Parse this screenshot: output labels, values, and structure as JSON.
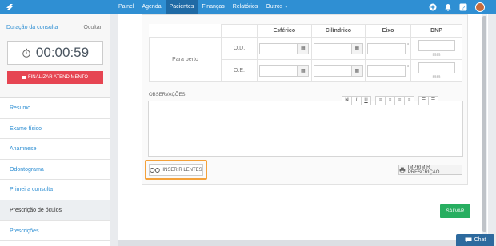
{
  "topbar": {
    "nav": [
      "Painel",
      "Agenda",
      "Pacientes",
      "Finanças",
      "Relatórios",
      "Outros"
    ],
    "active_index": 2,
    "brand_color": "#2f8fd3"
  },
  "sidebar": {
    "title": "Duração da consulta",
    "hide_link": "Ocultar",
    "timer": "00:00:59",
    "end_button": "FINALIZAR ATENDIMENTO",
    "menu": [
      "Resumo",
      "Exame físico",
      "Anamnese",
      "Odontograma",
      "Primeira consulta",
      "Prescrição de óculos",
      "Prescrições"
    ],
    "active_menu_index": 5
  },
  "prescription": {
    "headers": [
      "Esférico",
      "Cilíndrico",
      "Eixo",
      "DNP"
    ],
    "row_group": "Para perto",
    "rows": [
      "O.D.",
      "O.E."
    ],
    "degree_symbol": "°",
    "unit_mm": "mm",
    "btn_icon": "grid-icon"
  },
  "observations": {
    "label": "OBSERVAÇÕES",
    "toolbar": [
      "N",
      "I",
      "U",
      "≡",
      "≡",
      "≡",
      "≡",
      "☰",
      "☰"
    ]
  },
  "actions": {
    "insert_lenses": "INSERIR LENTES",
    "print": "IMPRIMIR PRESCRIÇÃO",
    "save": "SALVAR",
    "highlight_color": "#f4a13a",
    "save_color": "#27ae60",
    "end_color": "#e64552"
  },
  "chat": {
    "label": "Chat"
  }
}
